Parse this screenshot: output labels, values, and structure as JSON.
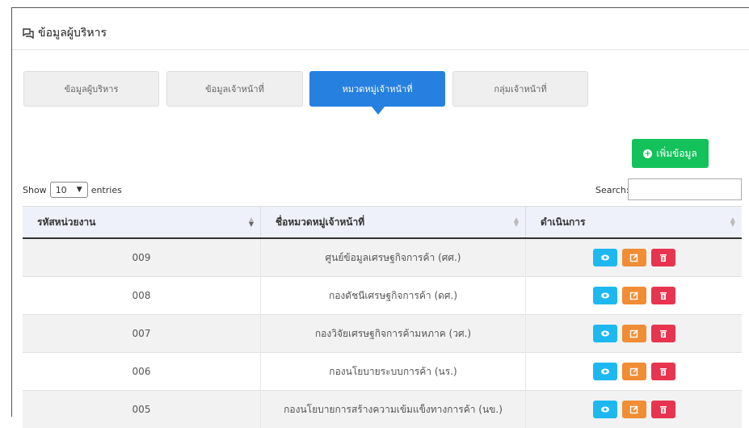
{
  "page": {
    "title": "ข้อมูลผู้บริหาร"
  },
  "tabs": [
    {
      "label": "ข้อมูลผู้บริหาร",
      "active": false
    },
    {
      "label": "ข้อมูลเจ้าหน้าที่",
      "active": false
    },
    {
      "label": "หมวดหมู่เจ้าหน้าที่",
      "active": true
    },
    {
      "label": "กลุ่มเจ้าหน้าที่",
      "active": false
    }
  ],
  "toolbar": {
    "add_label": "เพิ่มข้อมูล"
  },
  "length": {
    "show_label": "Show",
    "value": "10",
    "entries_label": "entries"
  },
  "search": {
    "label": "Search:",
    "value": ""
  },
  "table": {
    "columns": [
      "รหัสหน่วยงาน",
      "ชื่อหมวดหมู่เจ้าหน้าที่",
      "ดำเนินการ"
    ],
    "rows": [
      {
        "code": "009",
        "name": "ศูนย์ข้อมูลเศรษฐกิจการค้า (ศศ.)"
      },
      {
        "code": "008",
        "name": "กองดัชนีเศรษฐกิจการค้า (ดศ.)"
      },
      {
        "code": "007",
        "name": "กองวิจัยเศรษฐกิจการค้ามหภาค (วศ.)"
      },
      {
        "code": "006",
        "name": "กองนโยบายระบบการค้า (นร.)"
      },
      {
        "code": "005",
        "name": "กองนโยบายการสร้างความเข้มแข็งทางการค้า (นข.)"
      }
    ]
  },
  "colors": {
    "primary": "#2680e0",
    "success": "#14c25b",
    "info": "#1eb8f0",
    "warning": "#f08d35",
    "danger": "#e8354f"
  },
  "icons": {
    "title": "chat-icon",
    "add": "plus-circle-icon",
    "view": "eye-icon",
    "edit": "edit-icon",
    "delete": "trash-icon"
  }
}
